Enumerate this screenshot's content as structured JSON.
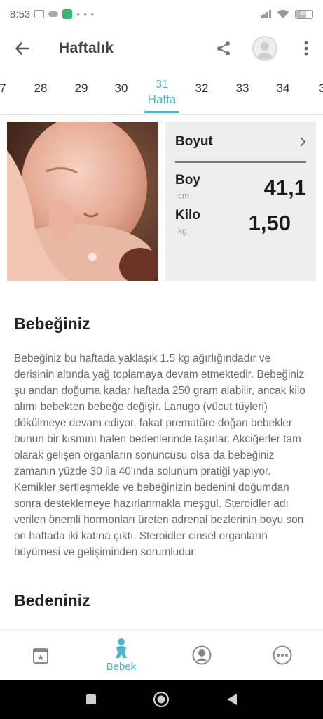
{
  "status_bar": {
    "time": "8:53",
    "battery": "4%"
  },
  "app_bar": {
    "title": "Haftalık"
  },
  "weeks": {
    "items": [
      "7",
      "28",
      "29",
      "30",
      "31",
      "32",
      "33",
      "34",
      "3"
    ],
    "active_label": "Hafta"
  },
  "size_card": {
    "title": "Boyut",
    "height_label": "Boy",
    "height_unit": "cm",
    "height_value": "41,1",
    "weight_label": "Kilo",
    "weight_unit": "kg",
    "weight_value": "1,50"
  },
  "sections": {
    "baby_title": "Bebeğiniz",
    "baby_text": "Bebeğiniz bu haftada yaklaşık 1.5 kg ağırlığındadır ve derisinin altında yağ toplamaya devam etmektedir. Bebeğiniz şu andan doğuma kadar haftada 250 gram alabilir, ancak kilo alımı bebekten bebeğe değişir. Lanugo (vücut tüyleri) dökülmeye devam ediyor, fakat prematüre doğan bebekler bunun bir kısmını halen bedenlerinde taşırlar. Akciğerler tam olarak gelişen organların sonuncusu olsa da bebeğiniz zamanın yüzde 30 ila 40'ında solunum pratiği yapıyor. Kemikler sertleşmekle ve bebeğinizin bedenini doğumdan sonra desteklemeye hazırlanmakla meşgul. Steroidler adı verilen önemli hormonları üreten adrenal bezlerinin boyu son on haftada iki katına çıktı. Steroidler cinsel organların büyümesi ve gelişiminden sorumludur.",
    "body_title": "Bedeniniz"
  },
  "bottom_nav": {
    "baby_label": "Bebek"
  },
  "colors": {
    "accent": "#4fb5c6"
  }
}
